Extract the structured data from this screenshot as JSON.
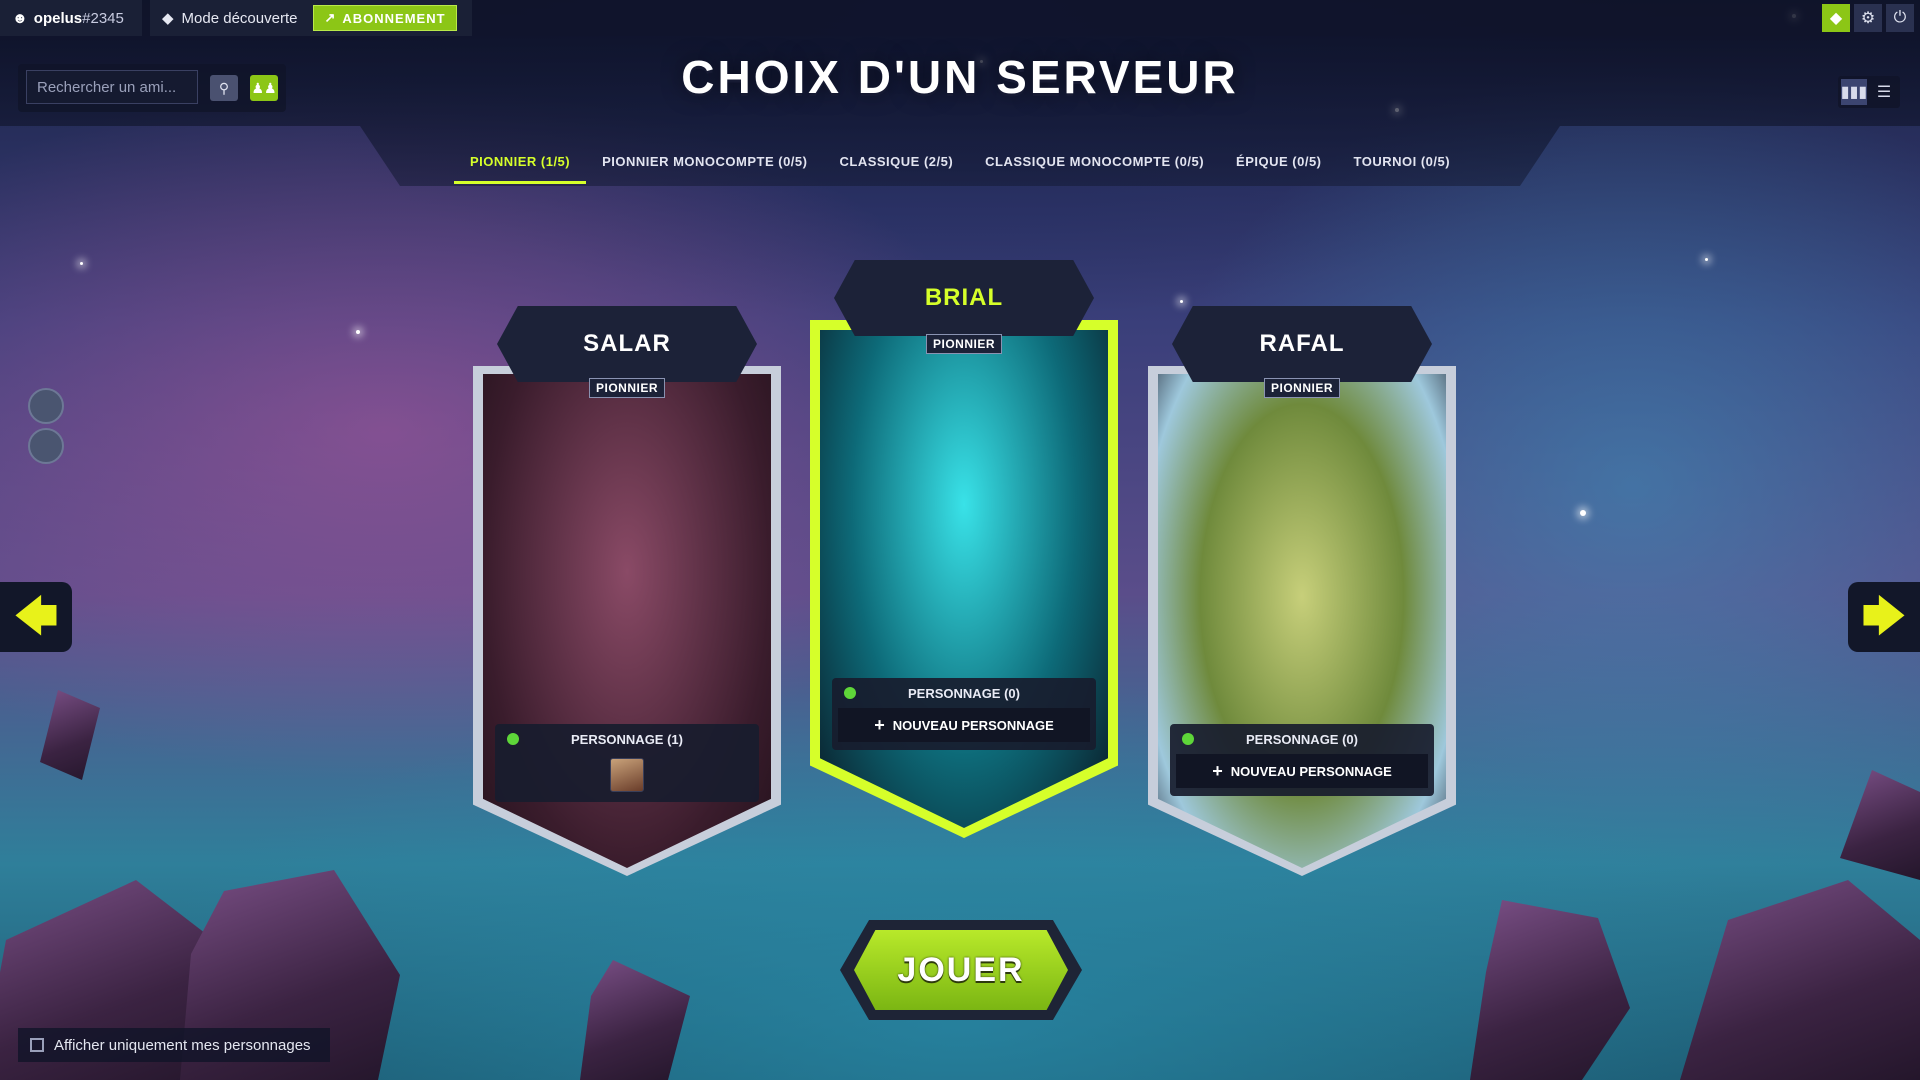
{
  "topbar": {
    "username": "opelus",
    "user_tag": "#2345",
    "mode_label": "Mode découverte",
    "subscribe_label": "ABONNEMENT",
    "icons": [
      "user-icon",
      "diamond-icon",
      "external-link-icon",
      "shop-icon",
      "gear-icon",
      "power-icon"
    ]
  },
  "friends": {
    "placeholder": "Rechercher un ami..."
  },
  "page_title": "CHOIX D'UN SERVEUR",
  "tabs": [
    {
      "label": "PIONNIER (1/5)",
      "active": true
    },
    {
      "label": "PIONNIER MONOCOMPTE (0/5)"
    },
    {
      "label": "CLASSIQUE (2/5)"
    },
    {
      "label": "CLASSIQUE MONOCOMPTE (0/5)"
    },
    {
      "label": "ÉPIQUE (0/5)"
    },
    {
      "label": "TOURNOI (0/5)"
    }
  ],
  "servers": [
    {
      "name": "SALAR",
      "type": "PIONNIER",
      "characters_label": "PERSONNAGE (1)",
      "status": "online"
    },
    {
      "name": "BRIAL",
      "type": "PIONNIER",
      "characters_label": "PERSONNAGE (0)",
      "new_label": "NOUVEAU PERSONNAGE",
      "status": "online",
      "selected": true
    },
    {
      "name": "RAFAL",
      "type": "PIONNIER",
      "characters_label": "PERSONNAGE (0)",
      "new_label": "NOUVEAU PERSONNAGE",
      "status": "online"
    }
  ],
  "play_label": "JOUER",
  "only_mine_label": "Afficher uniquement mes personnages",
  "colors": {
    "accent": "#d6ff2a",
    "play_green": "#8cc616",
    "online": "#5ed639",
    "panel": "#1c2238"
  }
}
